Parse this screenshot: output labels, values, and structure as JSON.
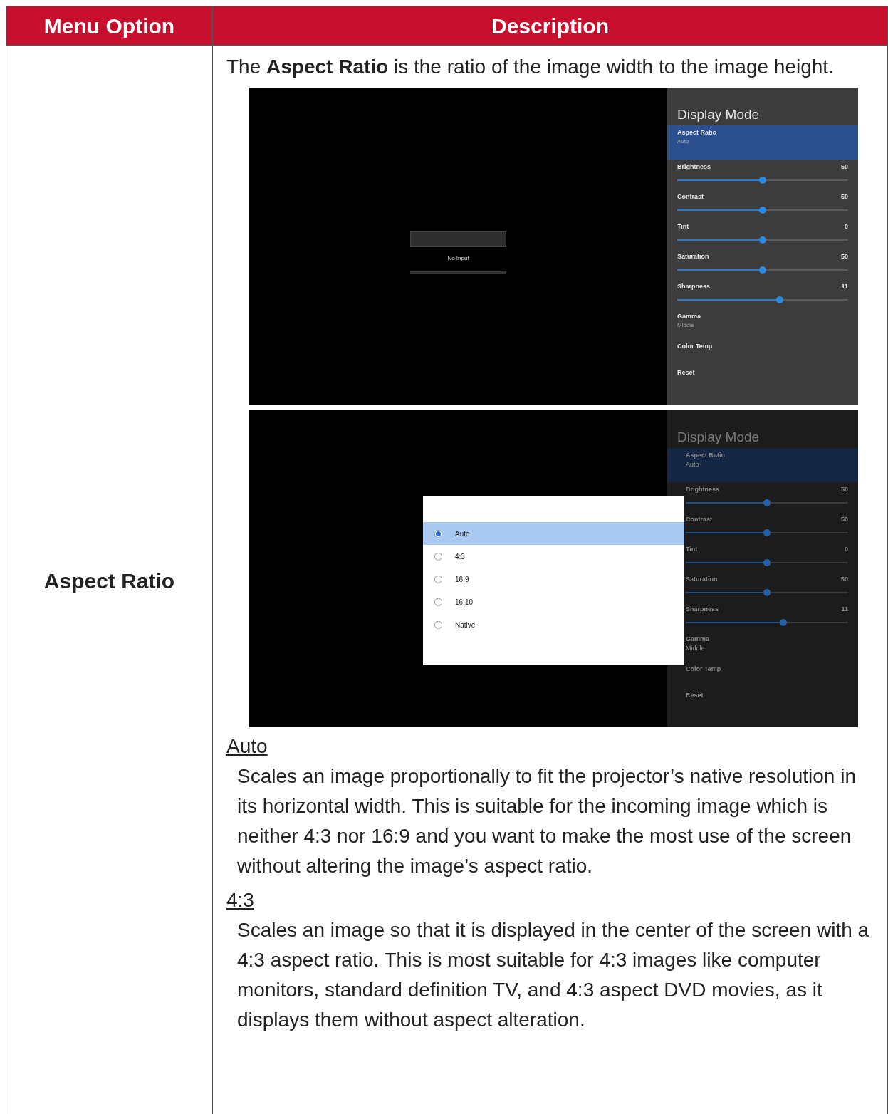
{
  "table": {
    "columns": [
      "Menu Option",
      "Description"
    ],
    "rows": [
      {
        "option": "Aspect Ratio",
        "intro": "The **Aspect Ratio** is the ratio of the image width to the image height.",
        "screenshots": [
          {
            "dimmed": false,
            "no_input": "No Input",
            "menu": {
              "title": "Display Mode",
              "items": [
                {
                  "kind": "select",
                  "label": "Aspect Ratio",
                  "value": "Auto",
                  "selected": true
                },
                {
                  "kind": "slider",
                  "label": "Brightness",
                  "value": "50",
                  "level": 0.5,
                  "selected": false
                },
                {
                  "kind": "slider",
                  "label": "Contrast",
                  "value": "50",
                  "level": 0.5,
                  "selected": false
                },
                {
                  "kind": "slider",
                  "label": "Tint",
                  "value": "0",
                  "level": 0.5,
                  "selected": false
                },
                {
                  "kind": "slider",
                  "label": "Saturation",
                  "value": "50",
                  "level": 0.5,
                  "selected": false
                },
                {
                  "kind": "slider",
                  "label": "Sharpness",
                  "value": "11",
                  "level": 0.6,
                  "selected": false
                },
                {
                  "kind": "select",
                  "label": "Gamma",
                  "value": "Middle",
                  "selected": false
                },
                {
                  "kind": "action",
                  "label": "Color Temp",
                  "selected": false
                },
                {
                  "kind": "action",
                  "label": "Reset",
                  "selected": false
                }
              ]
            }
          },
          {
            "dimmed": true,
            "menu": {
              "title": "Display Mode",
              "items": [
                {
                  "kind": "select",
                  "label": "Aspect Ratio",
                  "value": "Auto",
                  "selected": true
                },
                {
                  "kind": "slider",
                  "label": "Brightness",
                  "value": "50",
                  "level": 0.5,
                  "selected": false
                },
                {
                  "kind": "slider",
                  "label": "Contrast",
                  "value": "50",
                  "level": 0.5,
                  "selected": false
                },
                {
                  "kind": "slider",
                  "label": "Tint",
                  "value": "0",
                  "level": 0.5,
                  "selected": false
                },
                {
                  "kind": "slider",
                  "label": "Saturation",
                  "value": "50",
                  "level": 0.5,
                  "selected": false
                },
                {
                  "kind": "slider",
                  "label": "Sharpness",
                  "value": "11",
                  "level": 0.6,
                  "selected": false
                },
                {
                  "kind": "select",
                  "label": "Gamma",
                  "value": "Middle",
                  "selected": false
                },
                {
                  "kind": "action",
                  "label": "Color Temp",
                  "selected": false
                },
                {
                  "kind": "action",
                  "label": "Reset",
                  "selected": false
                }
              ]
            },
            "dialog": {
              "options": [
                {
                  "label": "Auto",
                  "selected": true
                },
                {
                  "label": "4:3",
                  "selected": false
                },
                {
                  "label": "16:9",
                  "selected": false
                },
                {
                  "label": "16:10",
                  "selected": false
                },
                {
                  "label": "Native",
                  "selected": false
                }
              ]
            }
          }
        ],
        "sections": [
          {
            "heading": "Auto",
            "text": "Scales an image proportionally to fit the projector’s native resolution in its horizontal width. This is suitable for the incoming image which is neither 4:3 nor 16:9 and you want to make the most use of the screen without altering the image’s aspect ratio."
          },
          {
            "heading": "4:3",
            "text": "Scales an image so that it is displayed in the center of the screen with a 4:3 aspect ratio. This is most suitable for 4:3 images like computer monitors, standard definition TV, and 4:3 aspect DVD movies, as it displays them without aspect alteration."
          }
        ]
      }
    ]
  }
}
